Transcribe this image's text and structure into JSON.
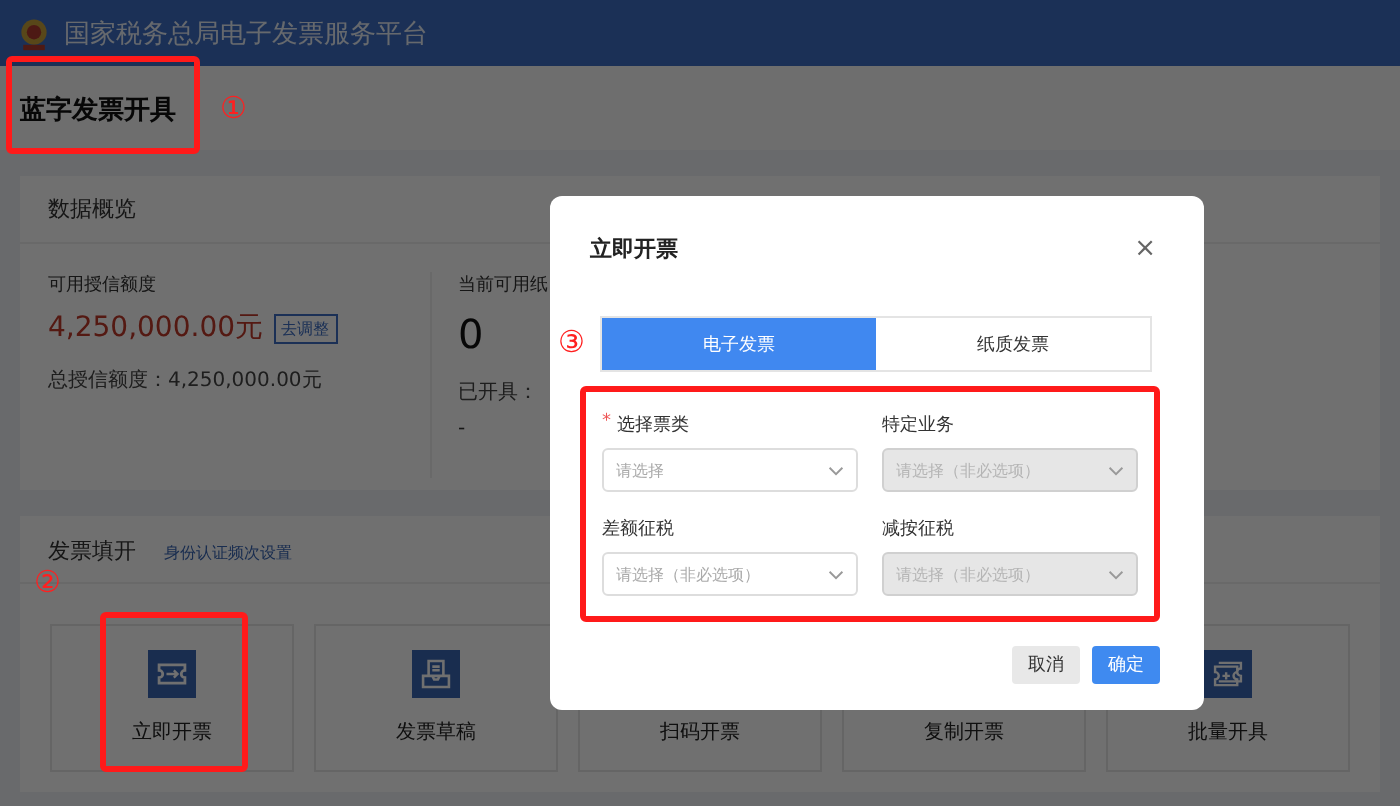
{
  "header": {
    "title": "国家税务总局电子发票服务平台"
  },
  "page_title": {
    "text": "蓝字发票开具",
    "highlighted": true,
    "marker": "①"
  },
  "overview": {
    "title": "数据概览",
    "columns": [
      {
        "label": "可用授信额度",
        "value": "4,250,000.00元",
        "kind": "amount",
        "action": "去调整",
        "detail": "总授信额度：4,250,000.00元"
      },
      {
        "label": "当前可用纸",
        "value": "0",
        "kind": "count",
        "detail": "已开具：",
        "extra": "-"
      }
    ]
  },
  "issue": {
    "title": "发票填开",
    "link": "身份认证频次设置",
    "tiles": [
      {
        "label": "立即开票",
        "kind": "ticket",
        "highlighted": true,
        "marker": "②"
      },
      {
        "label": "发票草稿",
        "kind": "draft",
        "highlighted": false
      },
      {
        "label": "扫码开票",
        "kind": "covered",
        "highlighted": false
      },
      {
        "label": "复制开票",
        "kind": "covered",
        "highlighted": false
      },
      {
        "label": "批量开具",
        "kind": "batch",
        "highlighted": false
      }
    ]
  },
  "modal": {
    "title": "立即开票",
    "close": "×",
    "tabs": [
      {
        "label": "电子发票",
        "selected": true
      },
      {
        "label": "纸质发票",
        "selected": false
      }
    ],
    "form_highlighted": true,
    "form_marker": "③",
    "fields": [
      {
        "label": "选择票类",
        "required_mark": "*",
        "placeholder": "请选择",
        "disabled": false
      },
      {
        "label": "特定业务",
        "placeholder": "请选择（非必选项）",
        "disabled": true
      },
      {
        "label": "差额征税",
        "placeholder": "请选择（非必选项）",
        "disabled": false
      },
      {
        "label": "减按征税",
        "placeholder": "请选择（非必选项）",
        "disabled": true
      }
    ],
    "buttons": [
      {
        "label": "取消",
        "kind": "secondary"
      },
      {
        "label": "确定",
        "kind": "primary"
      }
    ]
  }
}
